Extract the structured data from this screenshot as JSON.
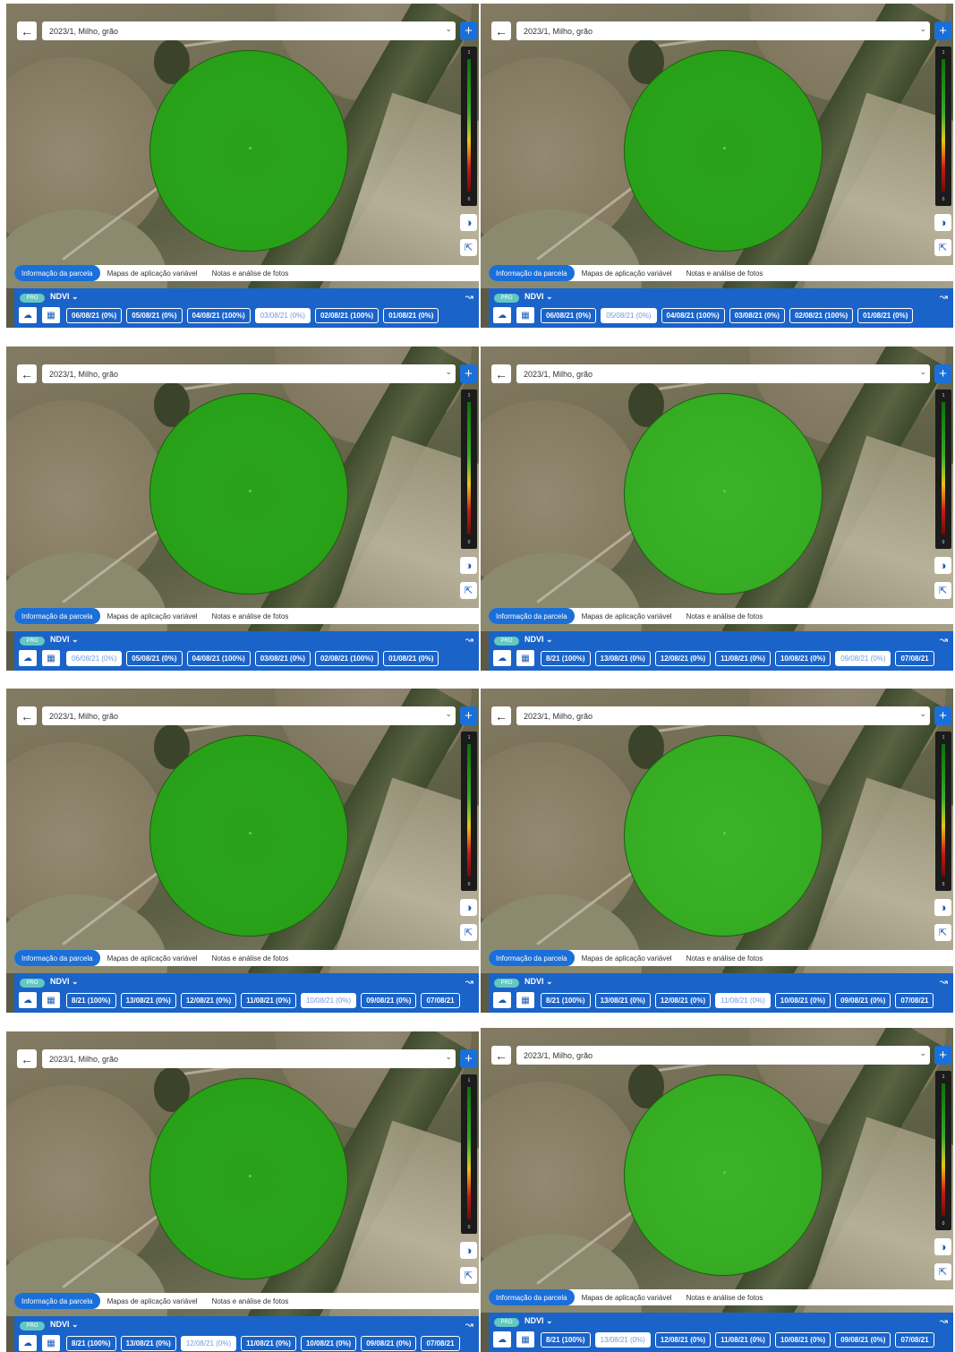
{
  "screen": {
    "back_icon": "arrow-left-icon",
    "crop_select": "2023/1, Milho, grão",
    "legend": {
      "max": "1",
      "min": "0"
    },
    "tabs": [
      "Informação da parcela",
      "Mapas de aplicação variável",
      "Notas e análise de fotos"
    ],
    "pro_badge": "PRO",
    "index_select": "NDVI",
    "colors": {
      "accent": "#1a6fd8",
      "pro": "#64c7c1",
      "ndvi_high": "#2aa41c"
    }
  },
  "date_sets": {
    "early": [
      "06/08/21 (0%)",
      "05/08/21 (0%)",
      "04/08/21 (100%)",
      "03/08/21 (0%)",
      "02/08/21 (100%)",
      "01/08/21 (0%)"
    ],
    "late": [
      "8/21 (100%)",
      "13/08/21 (0%)",
      "12/08/21 (0%)",
      "11/08/21 (0%)",
      "10/08/21 (0%)",
      "09/08/21 (0%)",
      "07/08/21"
    ]
  },
  "panels": [
    {
      "dates": "early",
      "selected": "03/08/21 (0%)",
      "tone": "dark"
    },
    {
      "dates": "early",
      "selected": "05/08/21 (0%)",
      "tone": "dark"
    },
    {
      "dates": "early",
      "selected": "06/08/21 (0%)",
      "tone": "dark"
    },
    {
      "dates": "late",
      "selected": "09/08/21 (0%)",
      "tone": "light"
    },
    {
      "dates": "late",
      "selected": "10/08/21 (0%)",
      "tone": "dark"
    },
    {
      "dates": "late",
      "selected": "11/08/21 (0%)",
      "tone": "light"
    },
    {
      "dates": "late",
      "selected": "12/08/21 (0%)",
      "tone": "dark"
    },
    {
      "dates": "late",
      "selected": "13/08/21 (0%)",
      "tone": "light"
    }
  ]
}
